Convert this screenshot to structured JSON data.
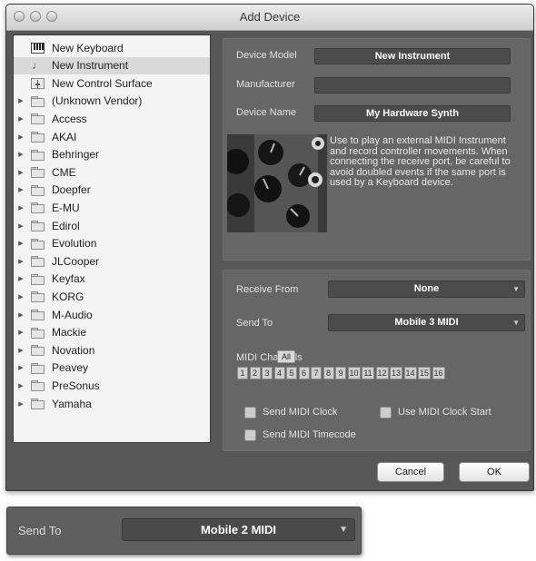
{
  "window": {
    "title": "Add Device"
  },
  "device_list": [
    {
      "label": "New Keyboard",
      "icon": "keyboard-icon",
      "expandable": false,
      "selected": false
    },
    {
      "label": "New Instrument",
      "icon": "instrument-icon",
      "expandable": false,
      "selected": true
    },
    {
      "label": "New Control Surface",
      "icon": "control-surface-icon",
      "expandable": false,
      "selected": false
    },
    {
      "label": "(Unknown Vendor)",
      "icon": "folder-icon",
      "expandable": true,
      "selected": false
    },
    {
      "label": "Access",
      "icon": "folder-icon",
      "expandable": true,
      "selected": false
    },
    {
      "label": "AKAI",
      "icon": "folder-icon",
      "expandable": true,
      "selected": false
    },
    {
      "label": "Behringer",
      "icon": "folder-icon",
      "expandable": true,
      "selected": false
    },
    {
      "label": "CME",
      "icon": "folder-icon",
      "expandable": true,
      "selected": false
    },
    {
      "label": "Doepfer",
      "icon": "folder-icon",
      "expandable": true,
      "selected": false
    },
    {
      "label": "E-MU",
      "icon": "folder-icon",
      "expandable": true,
      "selected": false
    },
    {
      "label": "Edirol",
      "icon": "folder-icon",
      "expandable": true,
      "selected": false
    },
    {
      "label": "Evolution",
      "icon": "folder-icon",
      "expandable": true,
      "selected": false
    },
    {
      "label": "JLCooper",
      "icon": "folder-icon",
      "expandable": true,
      "selected": false
    },
    {
      "label": "Keyfax",
      "icon": "folder-icon",
      "expandable": true,
      "selected": false
    },
    {
      "label": "KORG",
      "icon": "folder-icon",
      "expandable": true,
      "selected": false
    },
    {
      "label": "M-Audio",
      "icon": "folder-icon",
      "expandable": true,
      "selected": false
    },
    {
      "label": "Mackie",
      "icon": "folder-icon",
      "expandable": true,
      "selected": false
    },
    {
      "label": "Novation",
      "icon": "folder-icon",
      "expandable": true,
      "selected": false
    },
    {
      "label": "Peavey",
      "icon": "folder-icon",
      "expandable": true,
      "selected": false
    },
    {
      "label": "PreSonus",
      "icon": "folder-icon",
      "expandable": true,
      "selected": false
    },
    {
      "label": "Yamaha",
      "icon": "folder-icon",
      "expandable": true,
      "selected": false
    }
  ],
  "device_info": {
    "model_label": "Device Model",
    "model_value": "New Instrument",
    "manufacturer_label": "Manufacturer",
    "manufacturer_value": "",
    "name_label": "Device Name",
    "name_value": "My Hardware Synth",
    "description": "Use to play an external MIDI Instrument and record controller movements. When connecting the receive port, be careful to avoid doubled events if the same port is used by a Keyboard device."
  },
  "ports": {
    "receive_label": "Receive From",
    "receive_value": "None",
    "send_label": "Send To",
    "send_value": "Mobile 3 MIDI",
    "channels_label": "MIDI Channels",
    "all_label": "All",
    "channels": [
      "1",
      "2",
      "3",
      "4",
      "5",
      "6",
      "7",
      "8",
      "9",
      "10",
      "11",
      "12",
      "13",
      "14",
      "15",
      "16"
    ]
  },
  "options": {
    "send_clock": "Send MIDI Clock",
    "use_clock_start": "Use MIDI Clock Start",
    "send_timecode": "Send MIDI Timecode"
  },
  "buttons": {
    "cancel": "Cancel",
    "ok": "OK"
  },
  "callout": {
    "label": "Send To",
    "value": "Mobile 2 MIDI"
  }
}
